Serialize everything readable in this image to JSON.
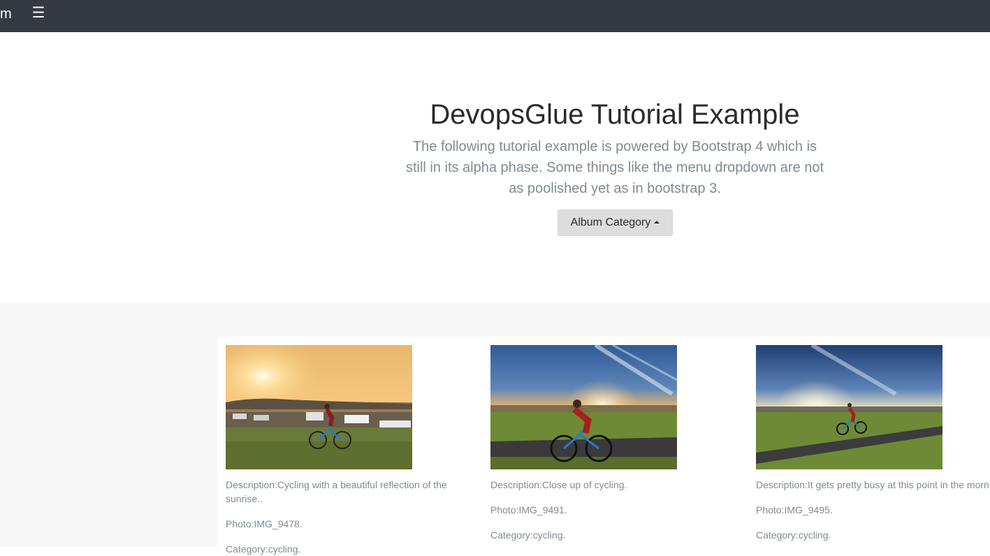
{
  "navbar": {
    "brand": "m",
    "toggler_glyph": "☰",
    "toggler_icon": "hamburger-menu-icon"
  },
  "jumbotron": {
    "title": "DevopsGlue Tutorial Example",
    "lead": "The following tutorial example is powered by Bootstrap 4 which is still in its alpha phase. Some things like the menu dropdown are not as poolished yet as in bootstrap 3.",
    "button_label": "Album Category"
  },
  "album": {
    "cards": [
      {
        "image": "cycling-sunrise-reflection-photo",
        "description": "Description:Cycling with a beautiful reflection of the sunrise..",
        "photo": "Photo:IMG_9478.",
        "category": "Category:cycling."
      },
      {
        "image": "cycling-closeup-photo",
        "description": "Description:Close up of cycling.",
        "photo": "Photo:IMG_9491.",
        "category": "Category:cycling."
      },
      {
        "image": "cycling-busy-morning-photo",
        "description": "Description:It gets pretty busy at this point in the morning.",
        "photo": "Photo:IMG_9495.",
        "category": "Category:cycling."
      }
    ]
  },
  "colors": {
    "navbar_bg": "#343a40",
    "album_bg": "#f7f7f7",
    "button_bg": "#dddddd",
    "muted_text": "#818a91"
  }
}
